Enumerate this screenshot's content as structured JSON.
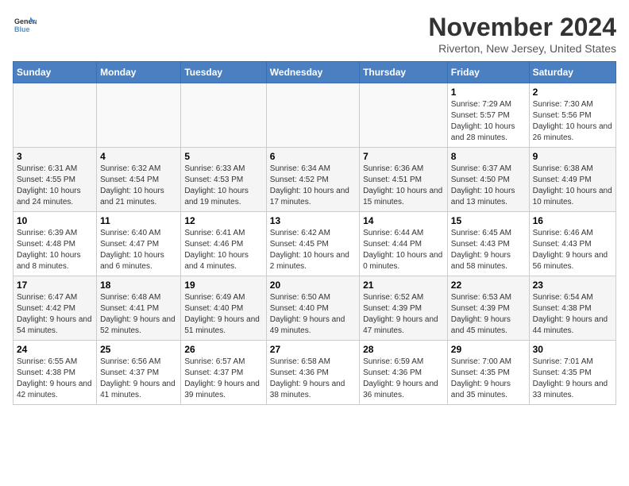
{
  "logo": {
    "general": "General",
    "blue": "Blue"
  },
  "title": "November 2024",
  "subtitle": "Riverton, New Jersey, United States",
  "days_header": [
    "Sunday",
    "Monday",
    "Tuesday",
    "Wednesday",
    "Thursday",
    "Friday",
    "Saturday"
  ],
  "weeks": [
    [
      {
        "day": "",
        "info": ""
      },
      {
        "day": "",
        "info": ""
      },
      {
        "day": "",
        "info": ""
      },
      {
        "day": "",
        "info": ""
      },
      {
        "day": "",
        "info": ""
      },
      {
        "day": "1",
        "info": "Sunrise: 7:29 AM\nSunset: 5:57 PM\nDaylight: 10 hours and 28 minutes."
      },
      {
        "day": "2",
        "info": "Sunrise: 7:30 AM\nSunset: 5:56 PM\nDaylight: 10 hours and 26 minutes."
      }
    ],
    [
      {
        "day": "3",
        "info": "Sunrise: 6:31 AM\nSunset: 4:55 PM\nDaylight: 10 hours and 24 minutes."
      },
      {
        "day": "4",
        "info": "Sunrise: 6:32 AM\nSunset: 4:54 PM\nDaylight: 10 hours and 21 minutes."
      },
      {
        "day": "5",
        "info": "Sunrise: 6:33 AM\nSunset: 4:53 PM\nDaylight: 10 hours and 19 minutes."
      },
      {
        "day": "6",
        "info": "Sunrise: 6:34 AM\nSunset: 4:52 PM\nDaylight: 10 hours and 17 minutes."
      },
      {
        "day": "7",
        "info": "Sunrise: 6:36 AM\nSunset: 4:51 PM\nDaylight: 10 hours and 15 minutes."
      },
      {
        "day": "8",
        "info": "Sunrise: 6:37 AM\nSunset: 4:50 PM\nDaylight: 10 hours and 13 minutes."
      },
      {
        "day": "9",
        "info": "Sunrise: 6:38 AM\nSunset: 4:49 PM\nDaylight: 10 hours and 10 minutes."
      }
    ],
    [
      {
        "day": "10",
        "info": "Sunrise: 6:39 AM\nSunset: 4:48 PM\nDaylight: 10 hours and 8 minutes."
      },
      {
        "day": "11",
        "info": "Sunrise: 6:40 AM\nSunset: 4:47 PM\nDaylight: 10 hours and 6 minutes."
      },
      {
        "day": "12",
        "info": "Sunrise: 6:41 AM\nSunset: 4:46 PM\nDaylight: 10 hours and 4 minutes."
      },
      {
        "day": "13",
        "info": "Sunrise: 6:42 AM\nSunset: 4:45 PM\nDaylight: 10 hours and 2 minutes."
      },
      {
        "day": "14",
        "info": "Sunrise: 6:44 AM\nSunset: 4:44 PM\nDaylight: 10 hours and 0 minutes."
      },
      {
        "day": "15",
        "info": "Sunrise: 6:45 AM\nSunset: 4:43 PM\nDaylight: 9 hours and 58 minutes."
      },
      {
        "day": "16",
        "info": "Sunrise: 6:46 AM\nSunset: 4:43 PM\nDaylight: 9 hours and 56 minutes."
      }
    ],
    [
      {
        "day": "17",
        "info": "Sunrise: 6:47 AM\nSunset: 4:42 PM\nDaylight: 9 hours and 54 minutes."
      },
      {
        "day": "18",
        "info": "Sunrise: 6:48 AM\nSunset: 4:41 PM\nDaylight: 9 hours and 52 minutes."
      },
      {
        "day": "19",
        "info": "Sunrise: 6:49 AM\nSunset: 4:40 PM\nDaylight: 9 hours and 51 minutes."
      },
      {
        "day": "20",
        "info": "Sunrise: 6:50 AM\nSunset: 4:40 PM\nDaylight: 9 hours and 49 minutes."
      },
      {
        "day": "21",
        "info": "Sunrise: 6:52 AM\nSunset: 4:39 PM\nDaylight: 9 hours and 47 minutes."
      },
      {
        "day": "22",
        "info": "Sunrise: 6:53 AM\nSunset: 4:39 PM\nDaylight: 9 hours and 45 minutes."
      },
      {
        "day": "23",
        "info": "Sunrise: 6:54 AM\nSunset: 4:38 PM\nDaylight: 9 hours and 44 minutes."
      }
    ],
    [
      {
        "day": "24",
        "info": "Sunrise: 6:55 AM\nSunset: 4:38 PM\nDaylight: 9 hours and 42 minutes."
      },
      {
        "day": "25",
        "info": "Sunrise: 6:56 AM\nSunset: 4:37 PM\nDaylight: 9 hours and 41 minutes."
      },
      {
        "day": "26",
        "info": "Sunrise: 6:57 AM\nSunset: 4:37 PM\nDaylight: 9 hours and 39 minutes."
      },
      {
        "day": "27",
        "info": "Sunrise: 6:58 AM\nSunset: 4:36 PM\nDaylight: 9 hours and 38 minutes."
      },
      {
        "day": "28",
        "info": "Sunrise: 6:59 AM\nSunset: 4:36 PM\nDaylight: 9 hours and 36 minutes."
      },
      {
        "day": "29",
        "info": "Sunrise: 7:00 AM\nSunset: 4:35 PM\nDaylight: 9 hours and 35 minutes."
      },
      {
        "day": "30",
        "info": "Sunrise: 7:01 AM\nSunset: 4:35 PM\nDaylight: 9 hours and 33 minutes."
      }
    ]
  ]
}
